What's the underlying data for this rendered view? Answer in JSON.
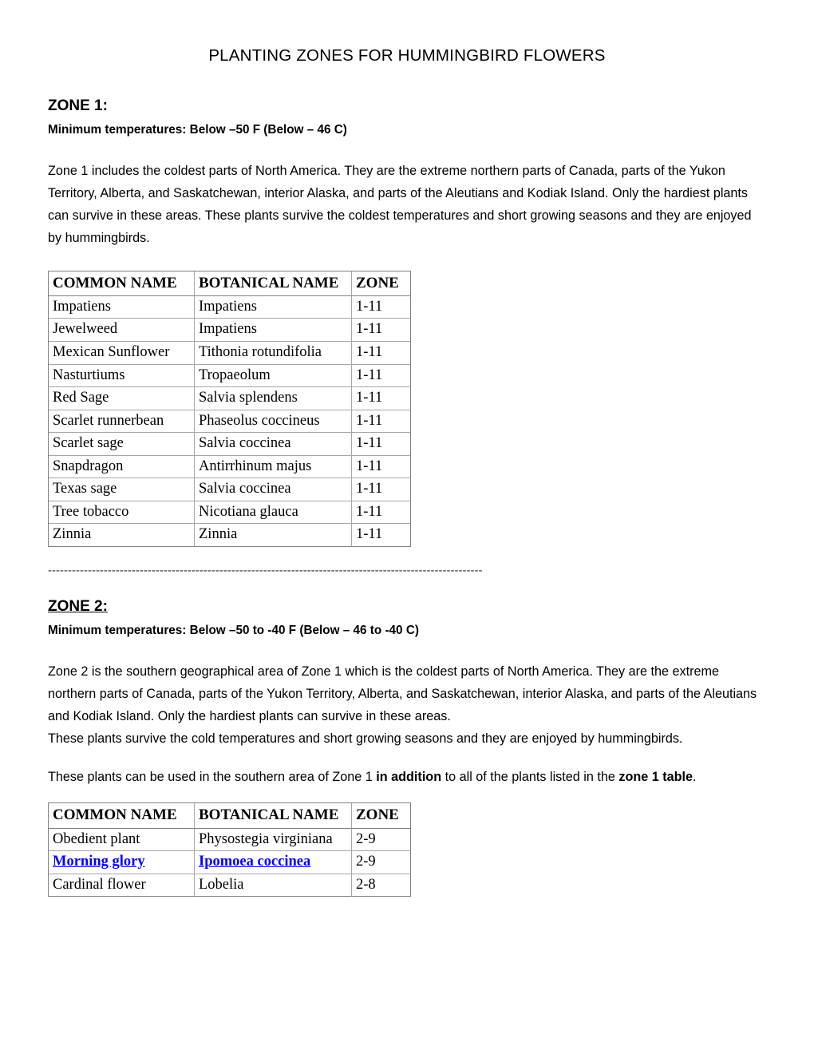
{
  "document": {
    "title": "PLANTING ZONES FOR HUMMINGBIRD FLOWERS",
    "separator": "-------------------------------------------------------------------------------------------------------------"
  },
  "link_color": "#0000FF",
  "zone1": {
    "heading": "ZONE 1:",
    "subheading": "Minimum temperatures: Below –50 F (Below – 46 C)",
    "paragraph": "Zone 1 includes the coldest parts of North America. They are the extreme northern parts of Canada, parts of the Yukon Territory, Alberta, and Saskatchewan, interior Alaska, and parts of the Aleutians and Kodiak Island. Only the hardiest plants can survive in these areas. These plants survive the coldest temperatures and short growing seasons and they are enjoyed by hummingbirds.",
    "table": {
      "headers": [
        "COMMON NAME",
        "BOTANICAL NAME",
        "ZONE"
      ],
      "rows": [
        {
          "common": "Impatiens",
          "botanical": "Impatiens",
          "zone": "1-11",
          "link": false
        },
        {
          "common": "Jewelweed",
          "botanical": "Impatiens",
          "zone": "1-11",
          "link": false
        },
        {
          "common": "Mexican Sunflower",
          "botanical": "Tithonia rotundifolia",
          "zone": "1-11",
          "link": false
        },
        {
          "common": "Nasturtiums",
          "botanical": "Tropaeolum",
          "zone": "1-11",
          "link": false
        },
        {
          "common": "Red Sage",
          "botanical": "Salvia splendens",
          "zone": "1-11",
          "link": false
        },
        {
          "common": "Scarlet runnerbean",
          "botanical": "Phaseolus coccineus",
          "zone": "1-11",
          "link": false
        },
        {
          "common": "Scarlet sage",
          "botanical": "Salvia coccinea",
          "zone": "1-11",
          "link": false
        },
        {
          "common": "Snapdragon",
          "botanical": "Antirrhinum majus",
          "zone": "1-11",
          "link": false
        },
        {
          "common": "Texas sage",
          "botanical": "Salvia coccinea",
          "zone": "1-11",
          "link": false
        },
        {
          "common": "Tree tobacco",
          "botanical": "Nicotiana glauca",
          "zone": "1-11",
          "link": false
        },
        {
          "common": "Zinnia",
          "botanical": "Zinnia",
          "zone": "1-11",
          "link": false
        }
      ]
    }
  },
  "zone2": {
    "heading": "ZONE 2:",
    "subheading": "Minimum temperatures: Below –50 to -40 F (Below – 46 to -40 C)",
    "paragraph": "Zone 2 is the southern geographical area of Zone 1 which is the coldest parts of North America. They are the extreme northern parts of Canada, parts of the Yukon Territory, Alberta, and Saskatchewan, interior Alaska, and parts of the Aleutians and Kodiak Island. Only the hardiest plants can survive in these areas.",
    "paragraph2": "These plants survive the cold temperatures and short growing seasons and they are enjoyed by hummingbirds.",
    "note": {
      "part1": "These plants can be used in the southern area of Zone 1 ",
      "bold1": "in addition",
      "part2": " to all of the plants listed in the ",
      "bold2": "zone 1 table",
      "part3": "."
    },
    "table": {
      "headers": [
        "COMMON NAME",
        "BOTANICAL NAME",
        "ZONE"
      ],
      "rows": [
        {
          "common": "Obedient plant",
          "botanical": "Physostegia virginiana",
          "zone": "2-9",
          "link": false
        },
        {
          "common": "Morning glory",
          "botanical": "Ipomoea coccinea",
          "zone": "2-9",
          "link": true
        },
        {
          "common": "Cardinal flower",
          "botanical": "Lobelia",
          "zone": "2-8",
          "link": false
        }
      ]
    }
  }
}
